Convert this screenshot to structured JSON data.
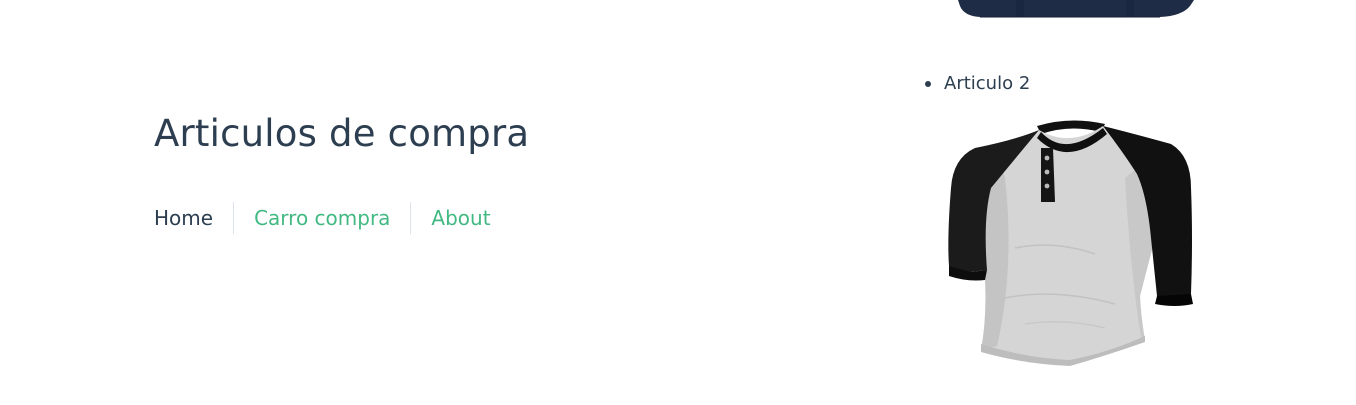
{
  "header": {
    "title": "Articulos de compra"
  },
  "nav": {
    "items": [
      {
        "label": "Home"
      },
      {
        "label": "Carro compra"
      },
      {
        "label": "About"
      }
    ]
  },
  "products": {
    "items": [
      {
        "name": "Articulo 2",
        "image": "henley-shirt-raglan"
      }
    ],
    "top_partial_image": "navy-bag"
  },
  "colors": {
    "text": "#2c3e50",
    "accent": "#42b983",
    "background": "#ffffff"
  }
}
